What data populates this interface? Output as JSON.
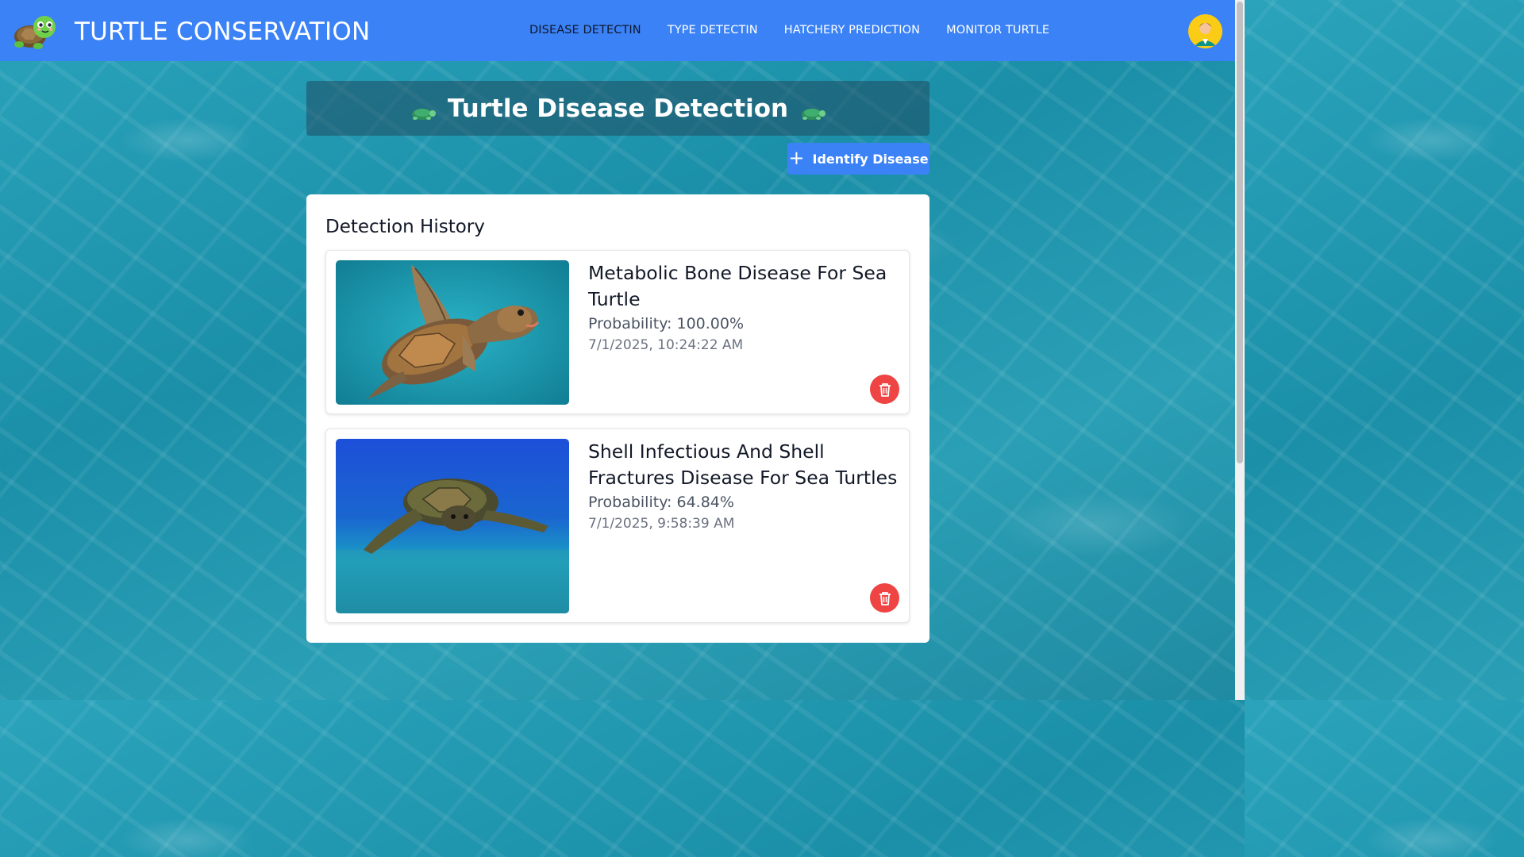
{
  "app": {
    "brand_title": "TURTLE CONSERVATION",
    "logo_icon": "turtle-icon",
    "avatar_icon": "user-avatar-icon"
  },
  "nav": {
    "items": [
      {
        "label": "DISEASE DETECTIN",
        "active": true
      },
      {
        "label": "TYPE DETECTIN",
        "active": false
      },
      {
        "label": "HATCHERY PREDICTION",
        "active": false
      },
      {
        "label": "MONITOR TURTLE",
        "active": false
      }
    ]
  },
  "page": {
    "title": "Turtle Disease Detection",
    "title_icon": "turtle-icon",
    "identify_button_label": "Identify Disease",
    "identify_button_icon": "plus-icon"
  },
  "history": {
    "heading": "Detection History",
    "items": [
      {
        "disease": "Metabolic Bone Disease For Sea Turtle",
        "probability": "Probability: 100.00%",
        "timestamp": "7/1/2025, 10:24:22 AM",
        "image": "turtle-photo",
        "delete_icon": "trash-icon"
      },
      {
        "disease": "Shell Infectious And Shell Fractures Disease For Sea Turtles",
        "probability": "Probability: 64.84%",
        "timestamp": "7/1/2025, 9:58:39 AM",
        "image": "turtle-photo",
        "delete_icon": "trash-icon"
      }
    ]
  },
  "colors": {
    "navbar": "#3b82f6",
    "primary_button": "#3b82f6",
    "delete_button": "#ef4444",
    "active_nav_text": "#0f172a"
  }
}
